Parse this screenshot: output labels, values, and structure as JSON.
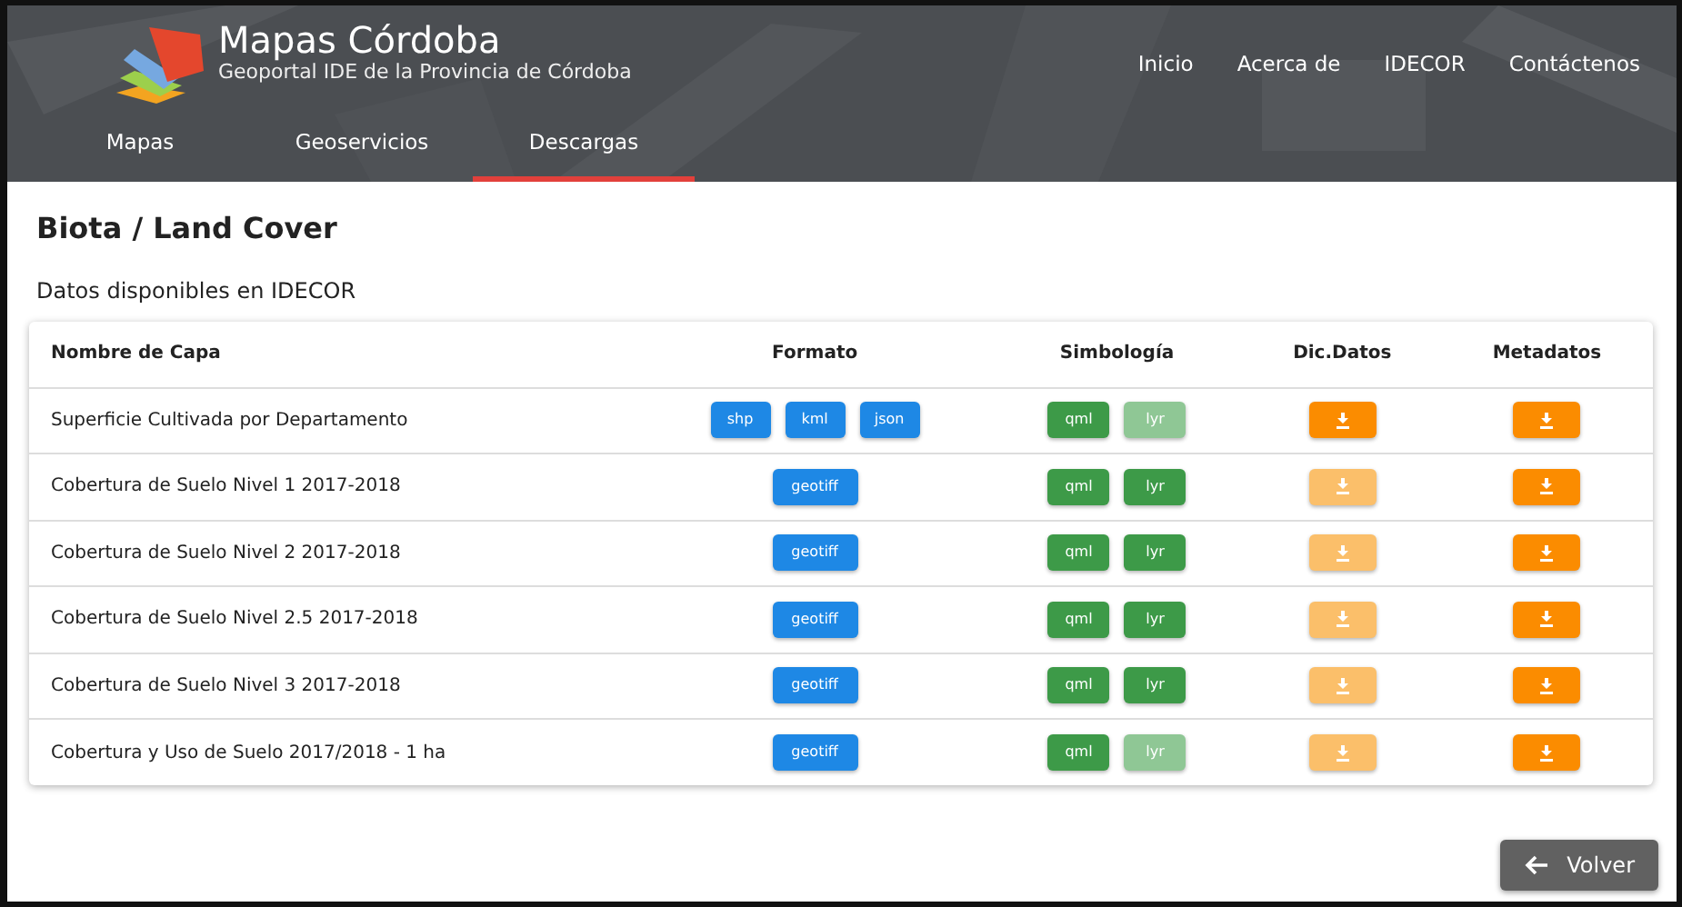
{
  "header": {
    "title": "Mapas Córdoba",
    "subtitle": "Geoportal IDE de la Provincia de Córdoba",
    "top_links": [
      "Inicio",
      "Acerca de",
      "IDECOR",
      "Contáctenos"
    ],
    "tabs": [
      {
        "label": "Mapas",
        "selected": false
      },
      {
        "label": "Geoservicios",
        "selected": false
      },
      {
        "label": "Descargas",
        "selected": true
      }
    ]
  },
  "page_title": "Biota / Land Cover",
  "subtitle": "Datos disponibles en IDECOR",
  "table": {
    "columns": [
      "Nombre de Capa",
      "Formato",
      "Simbología",
      "Dic.Datos",
      "Metadatos"
    ],
    "rows": [
      {
        "name": "Superficie Cultivada por Departamento",
        "formats": [
          "shp",
          "kml",
          "json"
        ],
        "symbology": [
          {
            "label": "qml",
            "disabled": false
          },
          {
            "label": "lyr",
            "disabled": true
          }
        ],
        "dic_disabled": false,
        "meta_disabled": false
      },
      {
        "name": "Cobertura de Suelo Nivel 1 2017-2018",
        "formats": [
          "geotiff"
        ],
        "symbology": [
          {
            "label": "qml",
            "disabled": false
          },
          {
            "label": "lyr",
            "disabled": false
          }
        ],
        "dic_disabled": true,
        "meta_disabled": false
      },
      {
        "name": "Cobertura de Suelo Nivel 2 2017-2018",
        "formats": [
          "geotiff"
        ],
        "symbology": [
          {
            "label": "qml",
            "disabled": false
          },
          {
            "label": "lyr",
            "disabled": false
          }
        ],
        "dic_disabled": true,
        "meta_disabled": false
      },
      {
        "name": "Cobertura de Suelo Nivel 2.5 2017-2018",
        "formats": [
          "geotiff"
        ],
        "symbology": [
          {
            "label": "qml",
            "disabled": false
          },
          {
            "label": "lyr",
            "disabled": false
          }
        ],
        "dic_disabled": true,
        "meta_disabled": false
      },
      {
        "name": "Cobertura de Suelo Nivel 3 2017-2018",
        "formats": [
          "geotiff"
        ],
        "symbology": [
          {
            "label": "qml",
            "disabled": false
          },
          {
            "label": "lyr",
            "disabled": false
          }
        ],
        "dic_disabled": true,
        "meta_disabled": false
      },
      {
        "name": "Cobertura y Uso de Suelo 2017/2018 - 1 ha",
        "formats": [
          "geotiff"
        ],
        "symbology": [
          {
            "label": "qml",
            "disabled": false
          },
          {
            "label": "lyr",
            "disabled": true
          }
        ],
        "dic_disabled": true,
        "meta_disabled": false
      }
    ]
  },
  "back_button": "Volver"
}
